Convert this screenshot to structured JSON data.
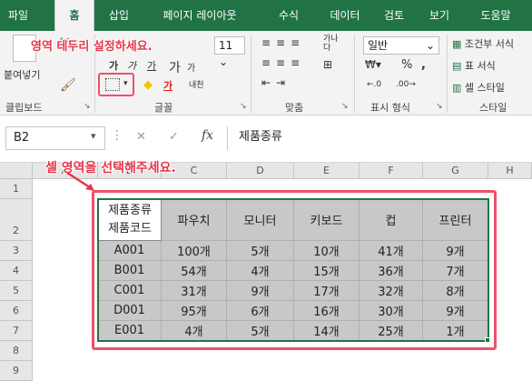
{
  "tabs": [
    "파일",
    "홈",
    "삽입",
    "페이지 레이아웃",
    "수식",
    "데이터",
    "검토",
    "보기",
    "도움말"
  ],
  "ribbon": {
    "paste_label": "붙여넣기",
    "font_size": "11",
    "bold": "가",
    "italic": "가",
    "underline": "가",
    "font_color_glyph": "가",
    "bigger_font": "가",
    "smaller_font": "가",
    "phonetic": "내천",
    "wrap_label": "가나\n다",
    "number_format": "일반",
    "percent": "%",
    "comma": ",",
    "cond_format": "조건부 서식",
    "table_format": "표 서식",
    "cell_style": "셀 스타일",
    "groups": {
      "clipboard": "클립보드",
      "font": "글꼴",
      "align": "맞춤",
      "number": "표시 형식",
      "style": "스타일"
    }
  },
  "formula_bar": {
    "name_box": "B2",
    "cancel": "✕",
    "enter": "✓",
    "fx": "fx",
    "value": "제품종류"
  },
  "grid": {
    "columns": [
      "A",
      "B",
      "C",
      "D",
      "E",
      "F",
      "G",
      "H"
    ],
    "rows": [
      "1",
      "2",
      "3",
      "4",
      "5",
      "6",
      "7",
      "8",
      "9"
    ],
    "header_corner": [
      "제품종류",
      "제품코드"
    ],
    "headers": [
      "파우치",
      "모니터",
      "키보드",
      "컵",
      "프린터"
    ],
    "data": [
      [
        "A001",
        "100개",
        "5개",
        "10개",
        "41개",
        "9개"
      ],
      [
        "B001",
        "54개",
        "4개",
        "15개",
        "36개",
        "7개"
      ],
      [
        "C001",
        "31개",
        "9개",
        "17개",
        "32개",
        "8개"
      ],
      [
        "D001",
        "95개",
        "6개",
        "16개",
        "30개",
        "9개"
      ],
      [
        "E001",
        "4개",
        "5개",
        "14개",
        "25개",
        "1개"
      ]
    ]
  },
  "annotations": {
    "border_hint": "영역 테두리 설정하세요.",
    "select_hint": "셀 영역을 선택해주세요."
  },
  "colors": {
    "accent": "#217346",
    "annotation": "#e8344a",
    "selection": "#c8c8c8"
  }
}
